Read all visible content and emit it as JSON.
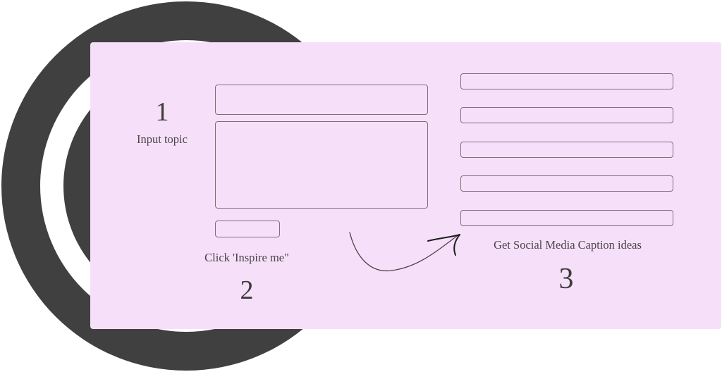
{
  "diagram": {
    "colors": {
      "panel": "#f6e0f9",
      "backdrop_ring": "#414041",
      "field_border": "#7c7078",
      "text": "#3f3b3d"
    },
    "steps": [
      {
        "number": "1",
        "label": "Input topic"
      },
      {
        "number": "2",
        "label": "Click 'Inspire me\""
      },
      {
        "number": "3",
        "label": "Get Social Media Caption ideas"
      }
    ],
    "inputs": {
      "topic_value": "",
      "details_value": "",
      "button_label": ""
    },
    "results": [
      "",
      "",
      "",
      "",
      ""
    ]
  }
}
